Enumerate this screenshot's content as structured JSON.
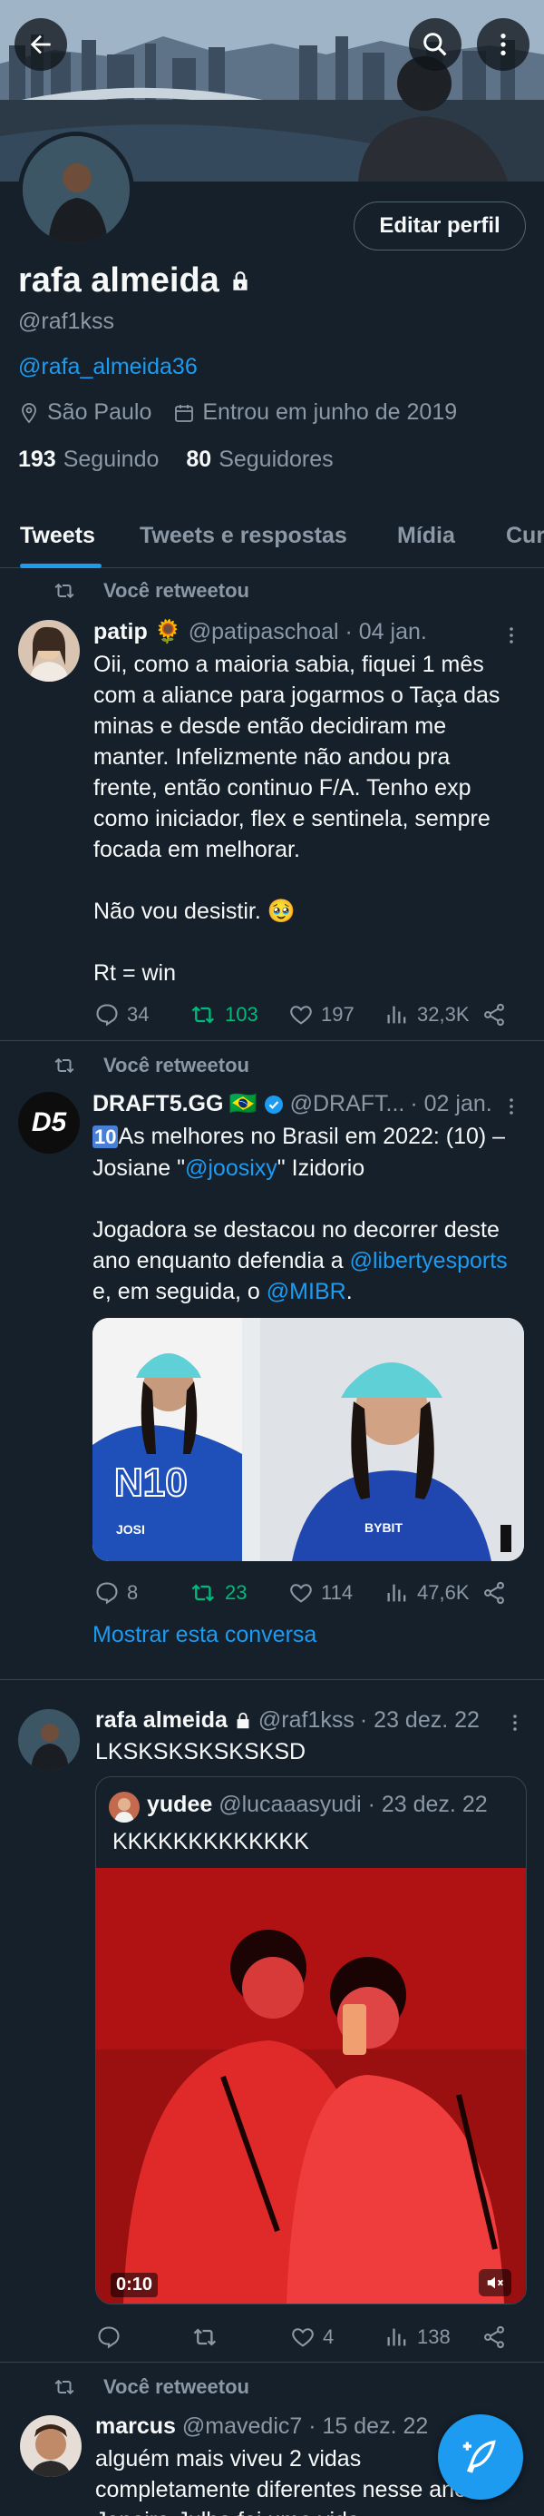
{
  "profile": {
    "name": "rafa almeida",
    "handle": "@raf1kss",
    "bio_link": "@rafa_almeida36",
    "location": "São Paulo",
    "joined": "Entrou em junho de 2019",
    "following_count": "193",
    "following_label": "Seguindo",
    "followers_count": "80",
    "followers_label": "Seguidores",
    "edit_label": "Editar perfil"
  },
  "tabs": [
    "Tweets",
    "Tweets e respostas",
    "Mídia",
    "Cur"
  ],
  "tweets": [
    {
      "retweet_label": "Você retweetou",
      "name": "patip",
      "emoji": "🌻",
      "handle": "@patipaschoal",
      "date": "· 04 jan.",
      "lines": [
        "Oii, como a maioria sabia, fiquei 1 mês",
        "com a aliance para jogarmos o Taça das",
        "minas e desde então decidiram me",
        "manter. Infelizmente não andou pra",
        "frente, então continuo F/A. Tenho exp",
        "como iniciador, flex e sentinela, sempre",
        "focada em melhorar.",
        "",
        "Não vou desistir. 🥹",
        "",
        "Rt = win"
      ],
      "replies": "34",
      "retweets": "103",
      "likes": "197",
      "views": "32,3K"
    },
    {
      "retweet_label": "Você retweetou",
      "name": "DRAFT5.GG",
      "emoji": "🇧🇷",
      "handle": "@DRAFT...",
      "date": "· 02 jan.",
      "avatar_text": "D5",
      "line1_badge": "10",
      "line1": "As melhores no Brasil em 2022: (10) –",
      "line2_a": "Josiane \"",
      "line2_link": "@joosixy",
      "line2_b": "\" Izidorio",
      "line3": "Jogadora se destacou no decorrer deste",
      "line4_a": "ano enquanto defendia a ",
      "line4_link": "@libertyesports",
      "line5_a": "e, em seguida, o ",
      "line5_link": "@MIBR",
      "line5_b": ".",
      "image_big_text": "N10",
      "image_caption": "JOSI",
      "image_jersey": "BYBIT",
      "replies": "8",
      "retweets": "23",
      "likes": "114",
      "views": "47,6K",
      "show_thread": "Mostrar esta conversa"
    },
    {
      "name": "rafa almeida",
      "handle": "@raf1kss",
      "date": "· 23 dez. 22",
      "text": "LKSKSKSKSKSKSD",
      "quote": {
        "name": "yudee",
        "handle": "@lucaaasyudi",
        "date": "· 23 dez. 22",
        "text": "KKKKKKKKKKKKK",
        "video_time": "0:10"
      },
      "likes": "4",
      "views": "138"
    },
    {
      "retweet_label": "Você retweetou",
      "name": "marcus",
      "handle": "@mavedic7",
      "date": "· 15 dez. 22",
      "lines": [
        "alguém mais viveu 2 vidas",
        "completamente diferentes nesse ano?",
        "Janeiro-Julho foi uma vida"
      ]
    }
  ],
  "colors": {
    "accent": "#1d9bf0",
    "retweet_green": "#00ba7c",
    "background": "#15202b",
    "muted": "#8b98a5"
  },
  "icons": [
    "back-arrow-icon",
    "search-icon",
    "more-vertical-icon",
    "lock-icon",
    "location-pin-icon",
    "calendar-icon",
    "retweet-icon",
    "reply-icon",
    "like-icon",
    "views-icon",
    "share-icon",
    "verified-icon",
    "mute-icon",
    "compose-icon"
  ]
}
